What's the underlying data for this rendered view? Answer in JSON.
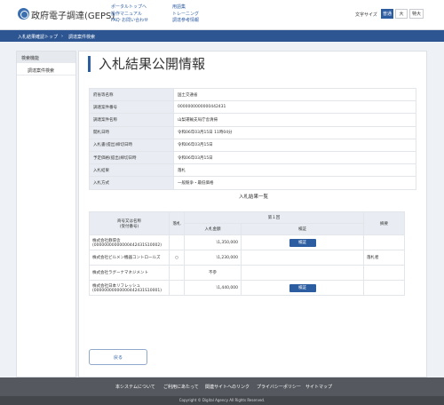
{
  "header": {
    "logo_text": "政府電子調達(GEPS)",
    "links_col1": [
      "ポータルトップへ",
      "操作マニュアル",
      "FAQ･お問い合わせ"
    ],
    "links_col2": [
      "用語集",
      "トレーニング",
      "調達参考情報"
    ],
    "font_size_label": "文字サイズ",
    "font_sizes": [
      "普通",
      "大",
      "特大"
    ],
    "active_font_size": "普通"
  },
  "breadcrumb": [
    "入札結果確認トップ",
    "調達案件検索"
  ],
  "sidebar": {
    "heading": "検索機能",
    "items": [
      "調達案件検索"
    ]
  },
  "main": {
    "title": "入札結果公開情報",
    "info_rows": [
      {
        "label": "府省等名称",
        "value": "国土交通省"
      },
      {
        "label": "調達案件番号",
        "value": "0000000000000442431"
      },
      {
        "label": "調達案件名称",
        "value": "山梨運輸支局庁舎清掃"
      },
      {
        "label": "開札日時",
        "value": "令和06年03月15日 11時04分"
      },
      {
        "label": "入札書(提出)締切日時",
        "value": "令和06年03月15日"
      },
      {
        "label": "予定価格(提出)締切日時",
        "value": "令和06年03月15日"
      },
      {
        "label": "入札結果",
        "value": "落札"
      },
      {
        "label": "入札方式",
        "value": "一般競争・最低価格"
      }
    ],
    "results_title": "入札結果一覧",
    "results_headers": {
      "company": "商号又は名称\n(受付番号)",
      "winner": "落札",
      "round": "第１回",
      "amount": "入札金額",
      "verify": "検証",
      "remarks": "摘要"
    },
    "results": [
      {
        "name": "株式会社静環舎",
        "receipt": "(00000000000000442431S10002)",
        "winner": "",
        "amount": "\\1,350,000",
        "verify": "検証",
        "remarks": ""
      },
      {
        "name": "株式会社ビルメン機器コントロールズ",
        "receipt": "",
        "winner": "○",
        "amount": "\\1,230,000",
        "verify": "",
        "remarks": "落札者"
      },
      {
        "name": "株式会社ラグーナマネジメント",
        "receipt": "",
        "winner": "",
        "amount": "不参",
        "verify": "",
        "remarks": ""
      },
      {
        "name": "株式会社日本リフレッシュ",
        "receipt": "(00000000000000442431S10001)",
        "winner": "",
        "amount": "\\1,440,000",
        "verify": "検証",
        "remarks": ""
      }
    ],
    "back_label": "戻る"
  },
  "footer": {
    "links": [
      "本システムについて",
      "ご利用にあたって",
      "関連サイトへのリンク",
      "プライバシーポリシー",
      "サイトマップ"
    ],
    "copyright": "Copyright © Digital Agency All Rights Reserved."
  },
  "colors": {
    "accent": "#2d5da1",
    "crumb_bar": "#2c5592",
    "footer": "#55595f"
  }
}
